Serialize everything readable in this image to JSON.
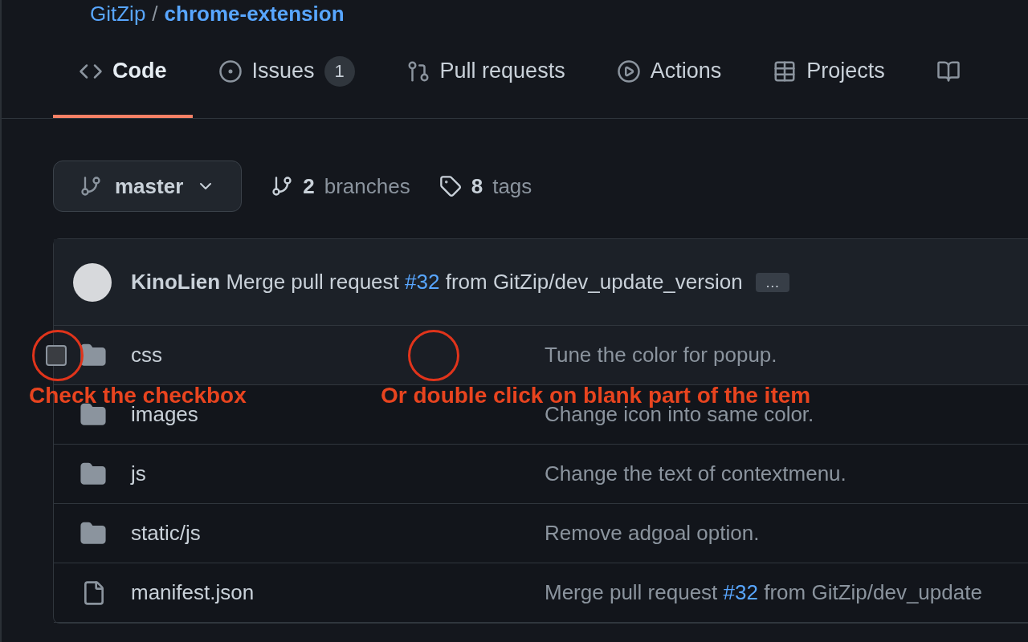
{
  "repo": {
    "owner": "GitZip",
    "separator": "/",
    "name": "chrome-extension"
  },
  "tabs": [
    {
      "kind": "code",
      "label": "Code",
      "selected": true
    },
    {
      "kind": "issues",
      "label": "Issues",
      "counter": "1",
      "selected": false
    },
    {
      "kind": "pulls",
      "label": "Pull requests",
      "selected": false
    },
    {
      "kind": "actions",
      "label": "Actions",
      "selected": false
    },
    {
      "kind": "projects",
      "label": "Projects",
      "selected": false
    },
    {
      "kind": "wiki",
      "selected": false
    }
  ],
  "branch": {
    "name": "master"
  },
  "branches": {
    "count": "2",
    "label": "branches"
  },
  "tags": {
    "count": "8",
    "label": "tags"
  },
  "commit": {
    "author": "KinoLien",
    "message": "Merge pull request",
    "link": "#32",
    "rest": "from GitZip/dev_update_version",
    "more": "…"
  },
  "files": [
    {
      "kind": "folder",
      "name": "css",
      "message": "Tune the color for popup.",
      "hovered": true,
      "checked": false
    },
    {
      "kind": "folder",
      "name": "images",
      "message": "Change icon into same color.",
      "hovered": false
    },
    {
      "kind": "folder",
      "name": "js",
      "message": "Change the text of contextmenu.",
      "hovered": false
    },
    {
      "kind": "folder",
      "name": "static/js",
      "message": "Remove adgoal option.",
      "hovered": false
    },
    {
      "kind": "file",
      "name": "manifest.json",
      "message": "Merge pull request",
      "link": "#32",
      "rest": "from GitZip/dev_update",
      "hovered": false
    }
  ],
  "annotations": [
    "Check the checkbox",
    "Or double click on blank part of the item"
  ]
}
